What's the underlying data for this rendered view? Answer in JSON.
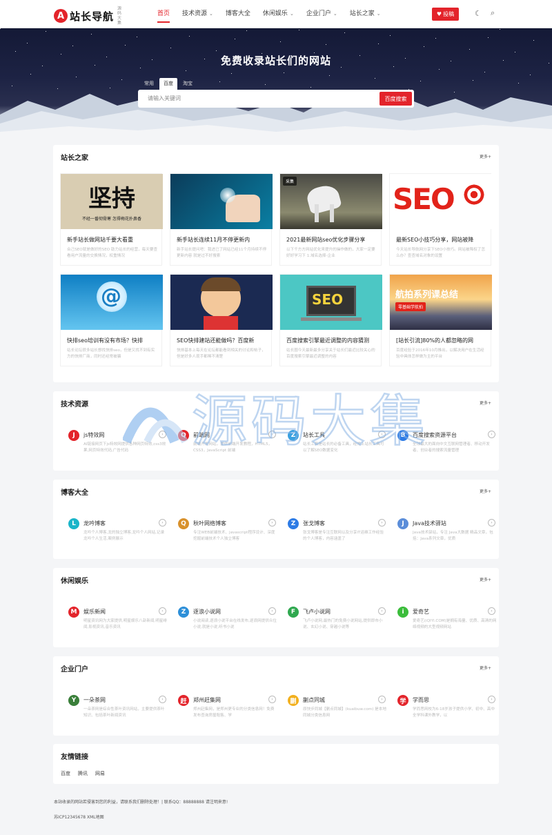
{
  "header": {
    "logo_mark": "A",
    "logo_text": "站长导航",
    "logo_sub": "源码大集",
    "nav": [
      {
        "label": "首页",
        "active": true,
        "caret": false
      },
      {
        "label": "技术资源",
        "active": false,
        "caret": true
      },
      {
        "label": "博客大全",
        "active": false,
        "caret": false
      },
      {
        "label": "休闲娱乐",
        "active": false,
        "caret": true
      },
      {
        "label": "企业门户",
        "active": false,
        "caret": true
      },
      {
        "label": "站长之家",
        "active": false,
        "caret": true
      }
    ],
    "submit_label": "投稿",
    "accent": "#e3242b"
  },
  "hero": {
    "title": "免费收录站长们的网站",
    "tabs": [
      "常用",
      "百度",
      "淘宝"
    ],
    "active_tab": "百度",
    "search_placeholder": "请输入关键词",
    "search_button": "百度搜索"
  },
  "sections": {
    "home": {
      "title": "站长之家",
      "more": "更多+",
      "cards": [
        {
          "title": "新手站长做网站千要大看重",
          "desc": "合己SEO就是做好的SEO 助力站长的经营，每天要查看用户流量的交换情况，权重情况",
          "tag": ""
        },
        {
          "title": "新手站长连续11月不停更新内",
          "desc": "新手站长提问吧：我进已了网站已经11个月持续不停更新内容 就是过不好搜索",
          "tag": ""
        },
        {
          "title": "2021最新网站seo优化步骤分享",
          "desc": "以下千方方网站优化来提升的操作做的，大家一定要好好学习下 1.域名选择-企业",
          "tag": "采集"
        },
        {
          "title": "最新SEO小技巧分享，网站被降",
          "desc": "今天站长导航网分享下SEO小技巧。网站被降权了怎么办？查查域名对象的设置",
          "tag": ""
        },
        {
          "title": "快排seo培训有没有市场？快排",
          "desc": "站长论坛很多站长想找快排seo，但是又找不到有实力的快排厂商，同时还经常被骗",
          "tag": ""
        },
        {
          "title": "SEO快排建站还能做吗？百度新",
          "desc": "快排基本上每天在论坛都能看到相关的讨论和帖子，但是好多人现手都稀不清楚",
          "tag": ""
        },
        {
          "title": "百度搜索引擎最近调整的内容猜测",
          "desc": "站长圈今天最新最多分享关于站长们最近比较关心的百度搜索引擎最近调整的内容",
          "tag": ""
        },
        {
          "title": "[站长引流]80%的人都忽略的网",
          "desc": "百度经验于2016年10月推出，以解决用户在生活经验中具体怎样做为主的平台",
          "tag": ""
        }
      ]
    },
    "tech": {
      "title": "技术资源",
      "more": "更多+",
      "sites": [
        {
          "name": "js特效网",
          "desc": "AI链接网页下js特效网提供各种网页特效,css3效果,网页特效代码,广告代码",
          "icon": "J",
          "color": "#e3242b"
        },
        {
          "name": "前端网",
          "desc": "前端开发网站，提供前端开发教程，HTML5，CSS3，JavaScript 前端",
          "icon": "Q",
          "color": "#e3242b"
        },
        {
          "name": "站长工具",
          "desc": "站长工具是站长的必备工具，经常上站长工具可以了解SEO数据变化",
          "icon": "Z",
          "color": "#3aa0e0"
        },
        {
          "name": "百度搜索资源平台",
          "desc": "全球最大的面向中文互联网管理者、移动开发者、创业者的搜索流量管理",
          "icon": "B",
          "color": "#2d7be5"
        }
      ]
    },
    "blog": {
      "title": "博客大全",
      "more": "更多+",
      "sites": [
        {
          "name": "龙吟博客",
          "desc": "龙吟个人博客,龙的独立博客,龙吟个人网站,记录龙吟个人生活,案例展示",
          "icon": "L",
          "color": "#1bb5c9"
        },
        {
          "name": "秋叶网络博客",
          "desc": "专注WEB前端技术、javascript程序设计、深度挖掘前端技术个人独立博客",
          "icon": "Q",
          "color": "#d8912c"
        },
        {
          "name": "张戈博客",
          "desc": "张戈博客是专注互联网以及分享IT运维工作经验的个人博客，内容涵盖了",
          "icon": "Z",
          "color": "#2d7be5"
        },
        {
          "name": "Java技术驿站",
          "desc": "Java技术驿站，专注 Java大数据 精品文章，包括：Java系列文章，优质",
          "icon": "J",
          "color": "#5b8dd9"
        }
      ]
    },
    "fun": {
      "title": "休闲娱乐",
      "more": "更多+",
      "sites": [
        {
          "name": "娱乐新闻",
          "desc": "明星资讯网为大家提供,明星娱乐八卦新闻,明星绯闻,影视资讯,音乐资讯",
          "icon": "M",
          "color": "#e3242b"
        },
        {
          "name": "逐浪小说网",
          "desc": "小说阅读,逐浪小说平台在线发布,逐浪网提供众位小说,就是小说,听书小说",
          "icon": "Z",
          "color": "#2d8fd8"
        },
        {
          "name": "飞卢小说网",
          "desc": "飞卢小说网,最热门的免费小说网站,提供即市小说、玄幻小说、穿越小说等",
          "icon": "F",
          "color": "#2fa84f"
        },
        {
          "name": "爱奇艺",
          "desc": "爱奇艺(iQIYI.COM)是拥有海量、优质、高清的网络视频的大型视频网站",
          "icon": "i",
          "color": "#3bbd3b"
        }
      ]
    },
    "biz": {
      "title": "企业门户",
      "more": "更多+",
      "sites": [
        {
          "name": "一朵茶网",
          "desc": "一朵茶网是综合性茶叶资讯网站，主要提供茶叶知识、包括茶叶新闻资讯",
          "icon": "Y",
          "color": "#3a7f3a"
        },
        {
          "name": "郑州赶集网",
          "desc": "郑州赶集网，是郑州更专业的分类信息网！免费发布查询房屋租售、学",
          "icon": "赶",
          "color": "#e3242b"
        },
        {
          "name": "蒯点同城",
          "desc": "原快步同城【蒯点同城】(kuaibuw.com) 是本地同城分类信息网",
          "icon": "蒯",
          "color": "#f2b01e"
        },
        {
          "name": "学而思",
          "desc": "学而思网校为6-18岁孩子提供小学、初中、高中全学科课外教学，以",
          "icon": "学",
          "color": "#e3242b"
        }
      ]
    },
    "links": {
      "title": "友情链接",
      "items": [
        "百度",
        "腾讯",
        "网易"
      ]
    }
  },
  "footer": {
    "line1": "本站收录的网站若侵害到您的利益，请联系我们删除处理！| 联系QQ：88888888 请注明来意!",
    "line2": "苏ICP12345678 XML地图"
  },
  "watermark": {
    "text": "源码大集"
  }
}
